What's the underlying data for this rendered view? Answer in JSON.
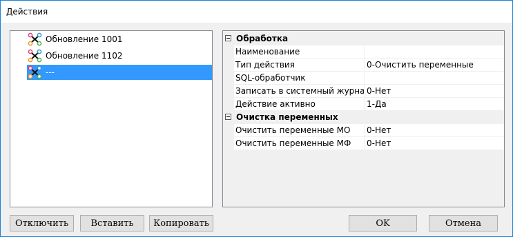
{
  "window": {
    "title": "Действия"
  },
  "tree": {
    "items": [
      {
        "label": "Обновление 1001",
        "icon": "workflow-icon",
        "selected": false
      },
      {
        "label": "Обновление 1102",
        "icon": "workflow-icon",
        "selected": false
      },
      {
        "label": "---",
        "icon": "workflow-icon",
        "selected": true
      }
    ]
  },
  "properties": {
    "category1": {
      "label": "Обработка",
      "rows": [
        {
          "name": "Наименование",
          "value": ""
        },
        {
          "name": "Тип действия",
          "value": "0-Очистить переменные"
        },
        {
          "name": "SQL-обработчик",
          "value": ""
        },
        {
          "name": "Записать в системный журнал",
          "value": "0-Нет"
        },
        {
          "name": "Действие активно",
          "value": "1-Да"
        }
      ]
    },
    "category2": {
      "label": "Очистка переменных",
      "rows": [
        {
          "name": "Очистить переменные МО",
          "value": "0-Нет"
        },
        {
          "name": "Очистить переменные МФ",
          "value": "0-Нет"
        }
      ]
    }
  },
  "buttons": {
    "disable": "Отключить",
    "insert": "Вставить",
    "copy": "Копировать",
    "ok": "OK",
    "cancel": "Отмена"
  },
  "colors": {
    "selection": "#3399ff",
    "border_accent": "#1883d7"
  }
}
